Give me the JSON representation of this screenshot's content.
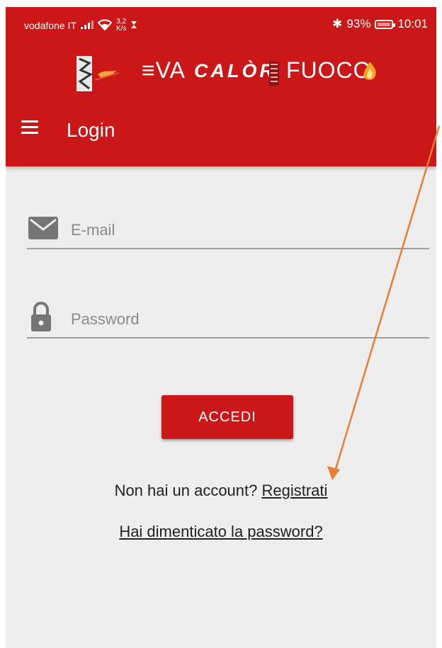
{
  "status_bar": {
    "carrier": "vodafone IT",
    "speed_value": "3,2",
    "speed_unit": "K/s",
    "bluetooth": "✱",
    "battery_percent": "93%",
    "time": "10:01"
  },
  "logo": {
    "brand_eva": "≡VA",
    "brand_calor": "CALÒR",
    "brand_fuoco": "FUOCO"
  },
  "header": {
    "title": "Login"
  },
  "form": {
    "email_placeholder": "E-mail",
    "password_placeholder": "Password",
    "submit_label": "ACCEDI"
  },
  "links": {
    "no_account_text": "Non hai un account? ",
    "register_label": "Registrati",
    "forgot_password_label": "Hai dimenticato la password?"
  },
  "colors": {
    "brand_red": "#cc1719",
    "background": "#eeeeee",
    "annotation_arrow": "#ed7d31"
  }
}
